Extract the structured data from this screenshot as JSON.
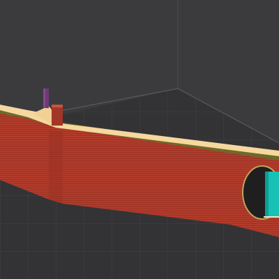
{
  "viewport": {
    "background_color": "#3b3b3d",
    "build_plate": {
      "surface_color": "#303033",
      "grid_line_color": "#424246",
      "edge_color": "#5e5e62",
      "back_wall_color": "#3f3f41"
    },
    "part": {
      "perimeter_color": "#b33d2c",
      "perimeter_shade_color": "#8f2c1f",
      "top_surface_color": "#f7d9a0",
      "inner_wall_color": "#6e6a2a",
      "seam_color": "#7a3b7a",
      "support_color": "#19c3b8",
      "hole_color": "#1f1f1f",
      "hole_rim_color": "#c9a65a"
    }
  }
}
